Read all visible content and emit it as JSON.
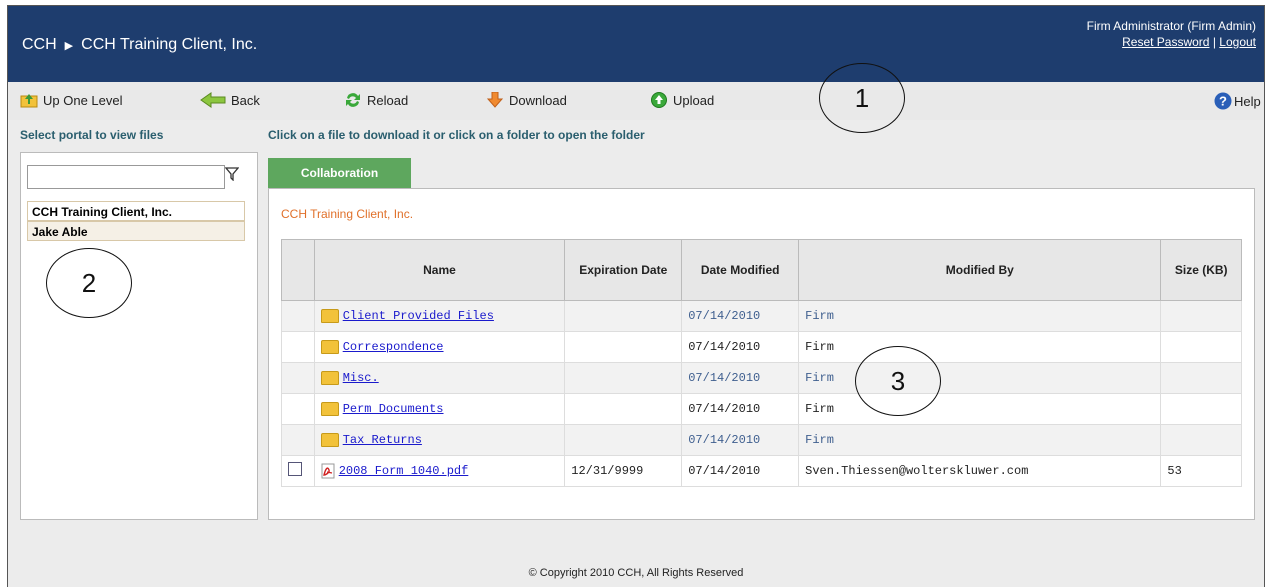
{
  "header": {
    "crumb_root": "CCH",
    "crumb_child": "CCH Training Client, Inc.",
    "user": "Firm Administrator (Firm Admin)",
    "reset_password": "Reset Password",
    "separator": "|",
    "logout": "Logout"
  },
  "toolbar": {
    "up": "Up One Level",
    "back": "Back",
    "reload": "Reload",
    "download": "Download",
    "upload": "Upload",
    "help": "Help"
  },
  "sidebar": {
    "title": "Select portal to view files",
    "filter_placeholder": "",
    "portals": [
      "CCH Training Client, Inc.",
      "Jake Able"
    ]
  },
  "main": {
    "instruction": "Click on a file to download it or click on a folder to open the folder",
    "tab": "Collaboration",
    "client": "CCH Training Client, Inc.",
    "columns": [
      "Name",
      "Expiration Date",
      "Date Modified",
      "Modified By",
      "Size (KB)"
    ],
    "rows": [
      {
        "name": "Client Provided Files",
        "expiration": "",
        "modified": "07/14/2010",
        "by": "Firm",
        "size": ""
      },
      {
        "name": "Correspondence",
        "expiration": "",
        "modified": "07/14/2010",
        "by": "Firm",
        "size": ""
      },
      {
        "name": "Misc.",
        "expiration": "",
        "modified": "07/14/2010",
        "by": "Firm",
        "size": ""
      },
      {
        "name": "Perm Documents",
        "expiration": "",
        "modified": "07/14/2010",
        "by": "Firm",
        "size": ""
      },
      {
        "name": "Tax Returns",
        "expiration": "",
        "modified": "07/14/2010",
        "by": "Firm",
        "size": ""
      },
      {
        "name": "2008 Form 1040.pdf",
        "expiration": "12/31/9999",
        "modified": "07/14/2010",
        "by": "Sven.Thiessen@wolterskluwer.com",
        "size": "53"
      }
    ]
  },
  "footer": "© Copyright 2010 CCH, All Rights Reserved",
  "annotations": [
    "1",
    "2",
    "3"
  ],
  "colors": {
    "header_bg": "#1e3d6e",
    "tab_bg": "#5ea75e",
    "accent_text": "#2a5e6e",
    "client_text": "#e0702a"
  }
}
